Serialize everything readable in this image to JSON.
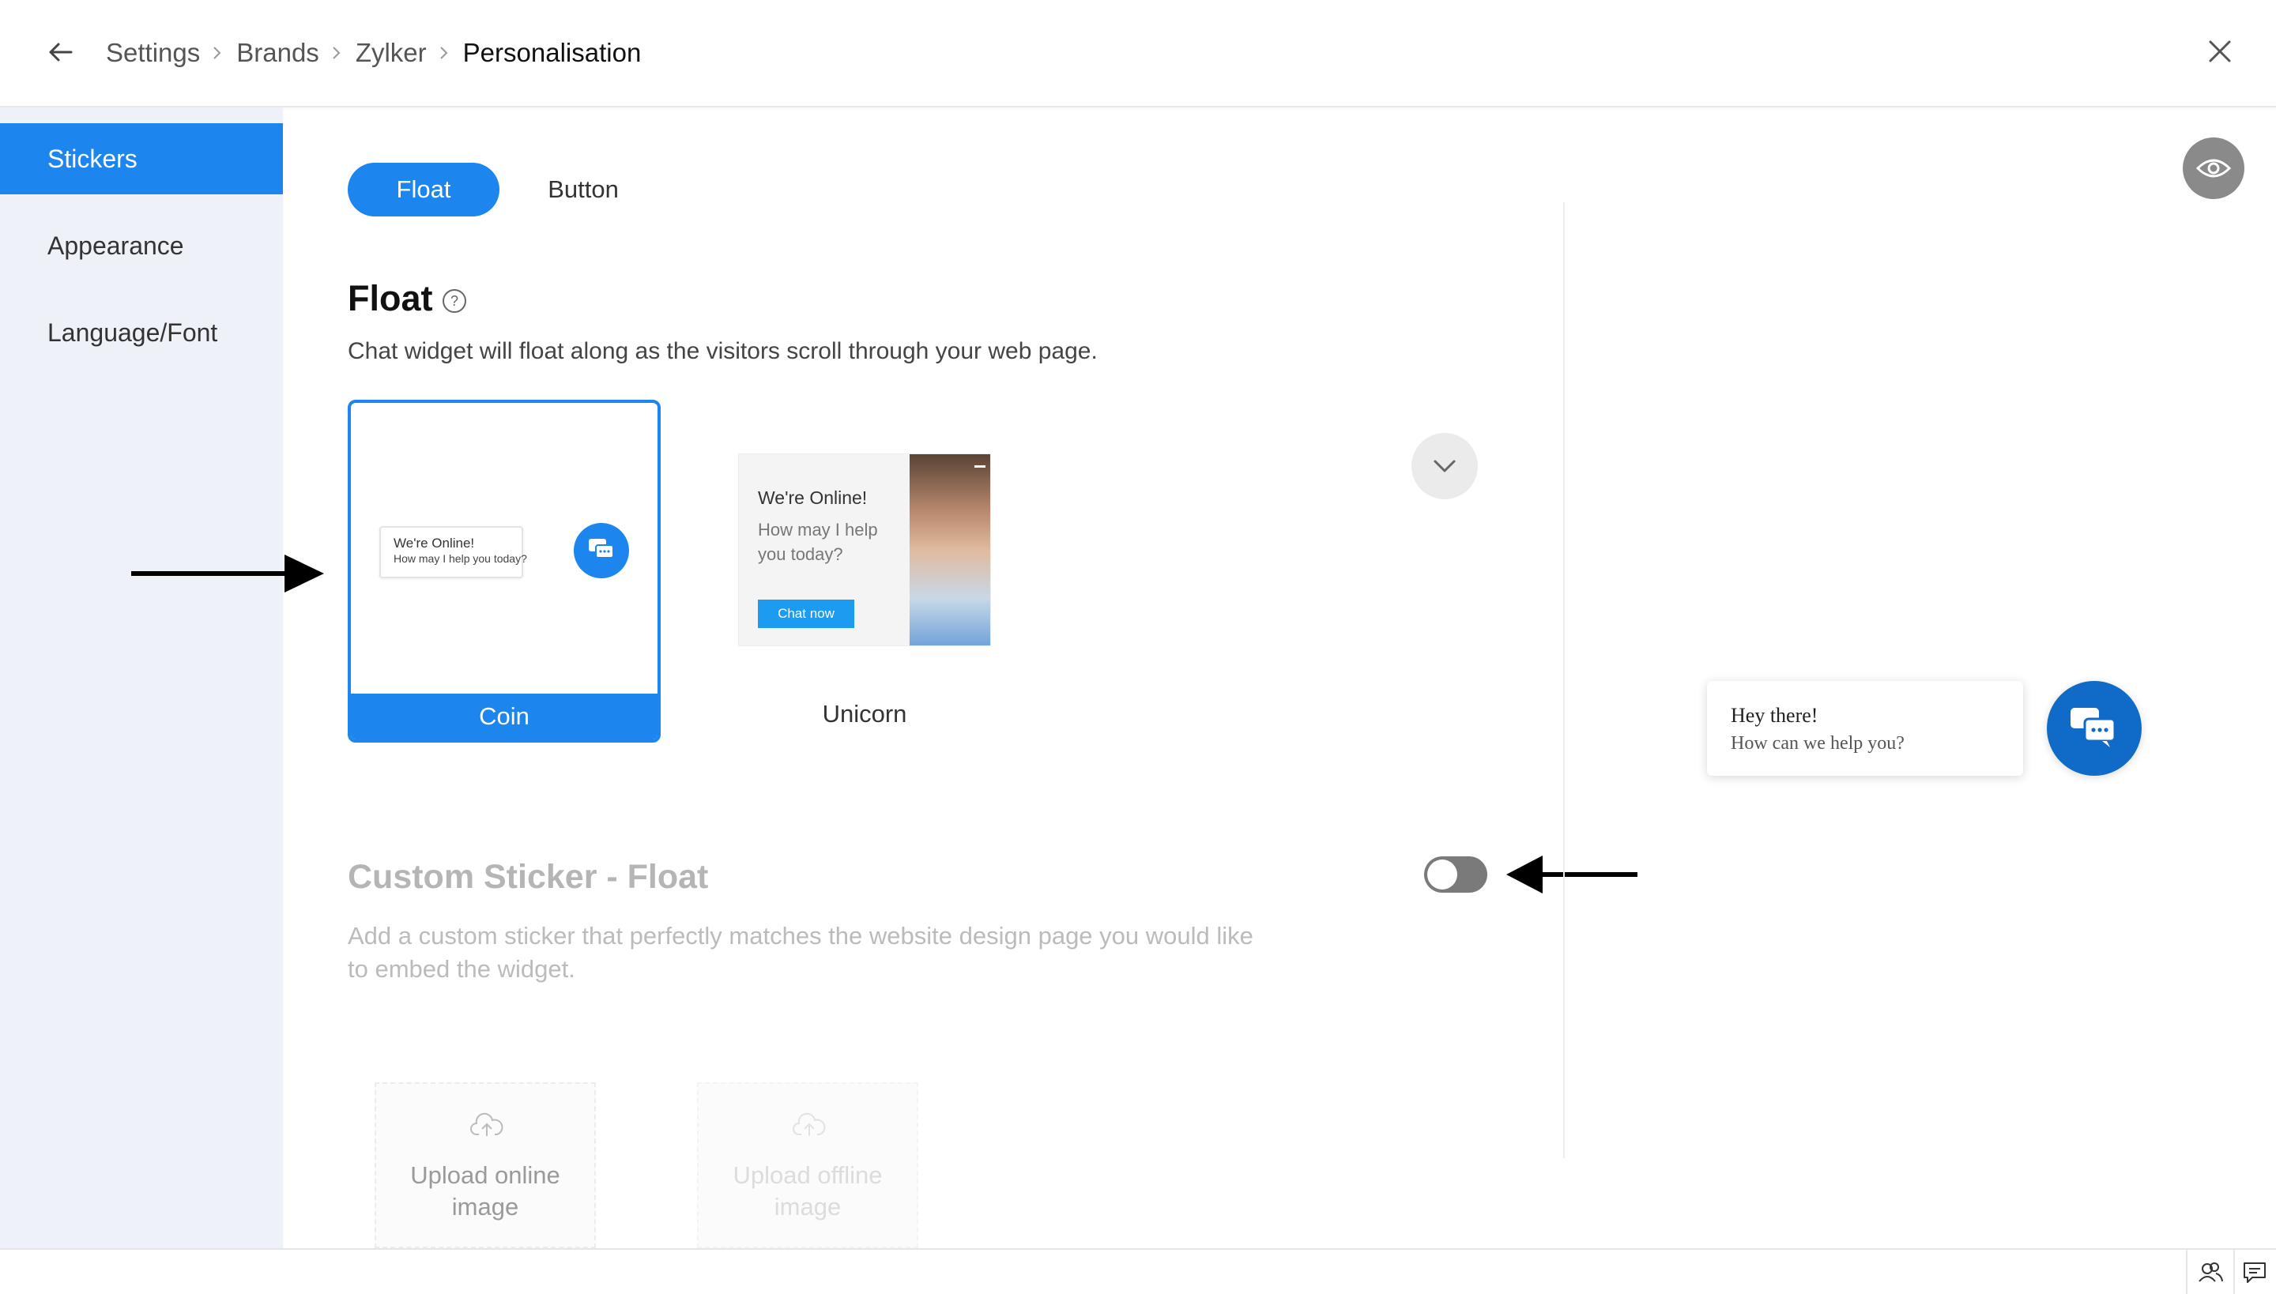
{
  "header": {
    "back_icon": "arrow-left-icon",
    "breadcrumbs": [
      "Settings",
      "Brands",
      "Zylker",
      "Personalisation"
    ],
    "close_icon": "close-icon"
  },
  "sidebar": {
    "items": [
      {
        "label": "Stickers",
        "active": true
      },
      {
        "label": "Appearance",
        "active": false
      },
      {
        "label": "Language/Font",
        "active": false
      }
    ]
  },
  "tabs": [
    {
      "label": "Float",
      "active": true
    },
    {
      "label": "Button",
      "active": false
    }
  ],
  "float_section": {
    "title": "Float",
    "description": "Chat widget will float along as the visitors scroll through your web page.",
    "stickers": [
      {
        "label": "Coin",
        "selected": true,
        "preview_line1": "We're Online!",
        "preview_line2": "How may I help you today?"
      },
      {
        "label": "Unicorn",
        "selected": false,
        "preview_title": "We're Online!",
        "preview_subtitle": "How may I help you today?",
        "preview_button": "Chat now"
      }
    ]
  },
  "custom_sticker": {
    "title": "Custom Sticker - Float",
    "description": "Add a custom sticker that perfectly matches the website design page you would like to embed the widget.",
    "enabled": false,
    "upload_online": "Upload online image",
    "upload_offline": "Upload offline image"
  },
  "preview": {
    "bubble_line1": "Hey there!",
    "bubble_line2": "How can we help you?",
    "eye_icon": "eye-icon"
  },
  "colors": {
    "accent": "#1d85ee",
    "sidebar_bg": "#eef1f7",
    "preview_coin": "#0f6bc7"
  }
}
